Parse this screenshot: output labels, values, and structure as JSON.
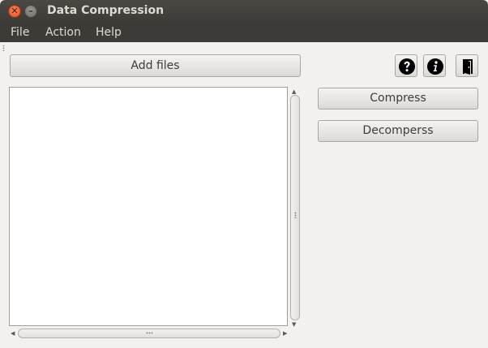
{
  "window": {
    "title": "Data Compression",
    "close_glyph": "✕",
    "minimize_glyph": "–"
  },
  "menu": {
    "items": [
      {
        "label": "File"
      },
      {
        "label": "Action"
      },
      {
        "label": "Help"
      }
    ]
  },
  "toolbar": {
    "add_files_label": "Add files",
    "icons": [
      "help-icon",
      "info-icon",
      "exit-door-icon"
    ]
  },
  "actions": {
    "compress_label": "Compress",
    "decompress_label": "Decomperss"
  },
  "file_list": {
    "items": []
  },
  "colors": {
    "titlebar": "#3c3b37",
    "close_button": "#df4a16",
    "window_bg": "#f2f1f0"
  }
}
